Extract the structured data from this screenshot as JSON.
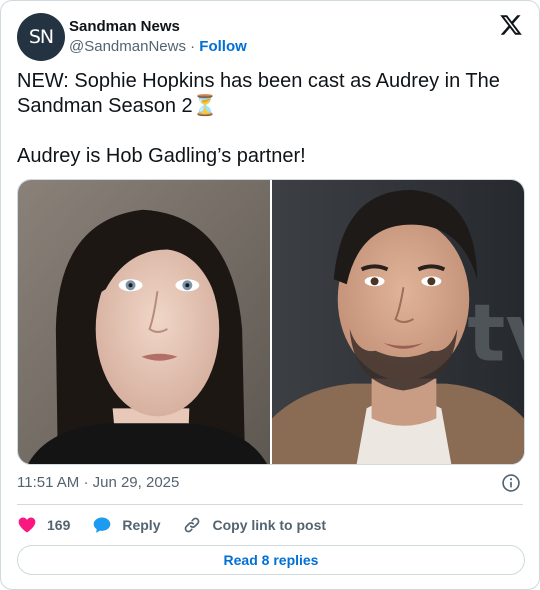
{
  "account": {
    "name": "Sandman News",
    "avatar_initials": "SN",
    "handle": "@SandmanNews",
    "separator": "·",
    "follow_label": "Follow"
  },
  "tweet": {
    "line1": "NEW: Sophie Hopkins has been cast as Audrey in The Sandman Season 2",
    "line1_emoji": "⏳",
    "line2": "Audrey is Hob Gadling’s partner!"
  },
  "media": {
    "left_photo": "woman-portrait",
    "right_photo": "man-portrait",
    "right_photo_bg_text": "tv"
  },
  "timestamp": {
    "time": "11:51 AM",
    "separator": "·",
    "date": "Jun 29, 2025"
  },
  "actions": {
    "like_count": "169",
    "reply_label": "Reply",
    "copy_label": "Copy link to post"
  },
  "read_replies_label": "Read 8 replies",
  "colors": {
    "link": "#006fd6",
    "like": "#f91880",
    "reply": "#1d9bf0",
    "muted": "#536471",
    "border": "#cfd9de"
  }
}
